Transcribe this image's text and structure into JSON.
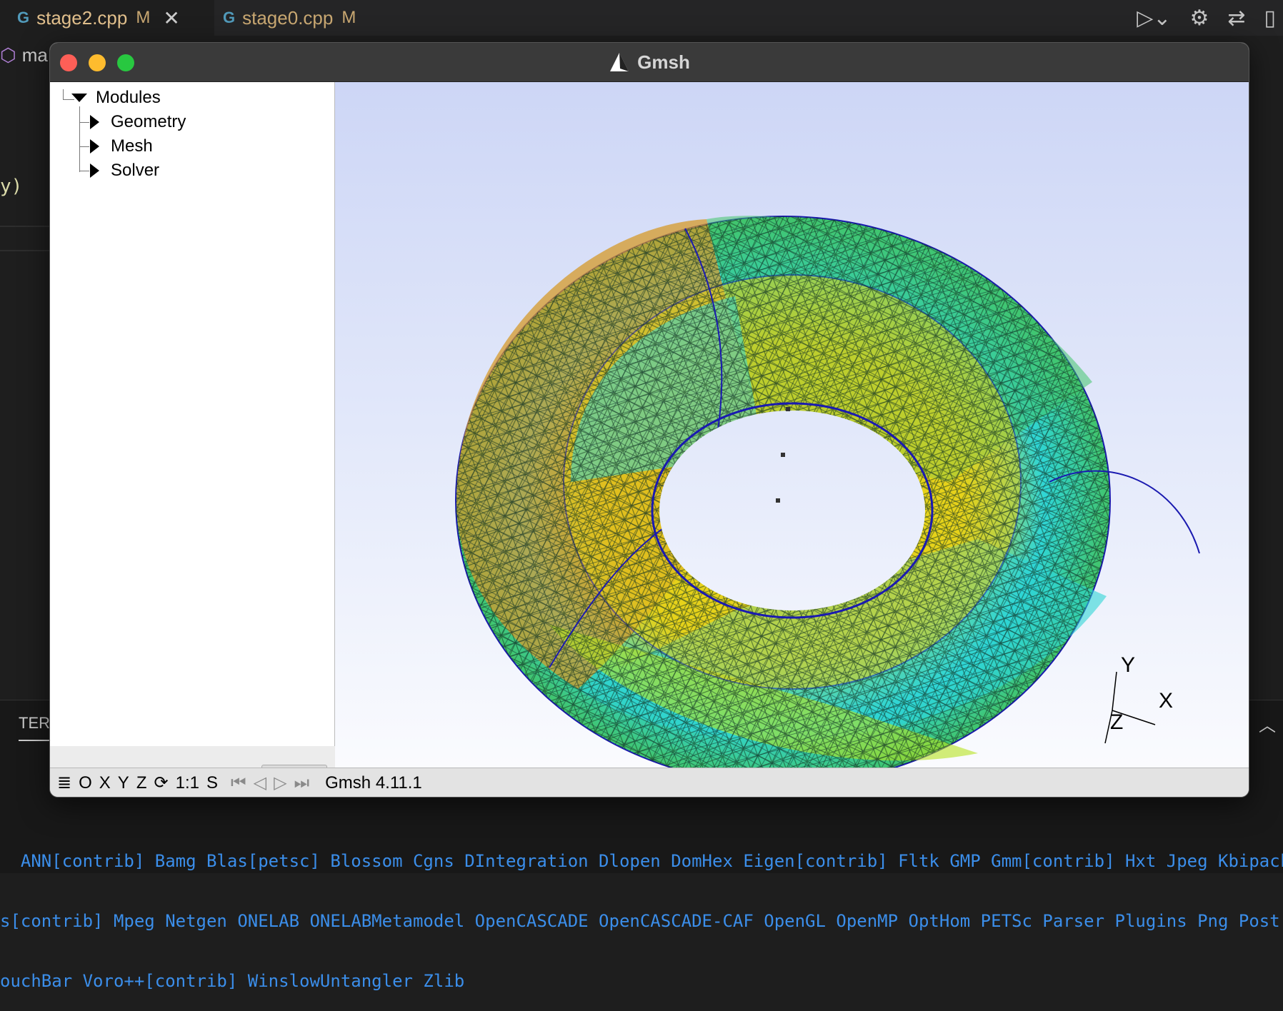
{
  "editor": {
    "tabs": [
      {
        "label": "stage2.cpp",
        "status": "M",
        "active": true
      },
      {
        "label": "stage0.cpp",
        "status": "M",
        "active": false
      }
    ],
    "breadcrumb_text": "ma",
    "code_fragment": "y)",
    "panel_tab": "TER",
    "terminal_lines": [
      "  ANN[contrib] Bamg Blas[petsc] Blossom Cgns DIntegration Dlopen DomHex Eigen[contrib] Fltk GMP Gmm[contrib] Hxt Jpeg Kbipack Lapa",
      "s[contrib] Mpeg Netgen ONELAB ONELABMetamodel OpenCASCADE OpenCASCADE-CAF OpenGL OpenMP OptHom PETSc Parser Plugins Png Post Quad",
      "ouchBar Voro++[contrib] WinslowUntangler Zlib"
    ]
  },
  "gmsh": {
    "title": "Gmsh",
    "tree": {
      "root": "Modules",
      "children": [
        "Geometry",
        "Mesh",
        "Solver"
      ]
    },
    "status": {
      "menu_icon": "≣",
      "o": "O",
      "x": "X",
      "y": "Y",
      "z": "Z",
      "rotate_icon": "⟳",
      "one_to_one": "1:1",
      "s": "S",
      "version": "Gmsh 4.11.1"
    },
    "axes": {
      "x": "X",
      "y": "Y",
      "z": "Z"
    }
  },
  "colors": {
    "mesh_yellow": "#e6d21a",
    "mesh_cyan": "#2fd6d6",
    "mesh_green": "#41c46b",
    "mesh_orange": "#d59a2a",
    "mesh_lime": "#b6e21e",
    "outline_blue": "#1a1ab0"
  }
}
